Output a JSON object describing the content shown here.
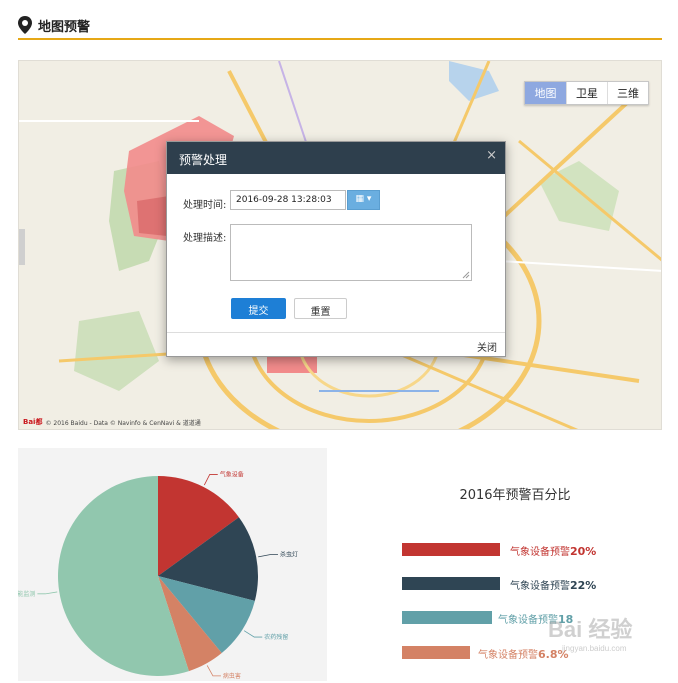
{
  "header": {
    "title": "地图预警"
  },
  "map": {
    "switch": [
      "地图",
      "卫星",
      "三维"
    ],
    "copyright_logo": "Bai都",
    "copyright_text": "© 2016 Baidu - Data © Navinfo & CenNavi & 道道通"
  },
  "modal": {
    "title": "预警处理",
    "close_icon": "×",
    "time_label": "处理时间:",
    "time_value": "2016-09-28 13:28:03",
    "calendar_icon": "▦ ▾",
    "desc_label": "处理描述:",
    "submit_label": "提交",
    "reset_label": "重置",
    "footer_close": "关闭"
  },
  "pie": {
    "labels": [
      "气象设备",
      "杀虫灯",
      "农药残留",
      "病虫害",
      "智能监测"
    ]
  },
  "chart_data": [
    {
      "type": "pie",
      "categories": [
        "气象设备",
        "杀虫灯",
        "农药残留",
        "病虫害",
        "智能监测"
      ],
      "values": [
        15,
        14,
        10,
        6,
        55
      ],
      "colors": [
        "#c23531",
        "#2f4554",
        "#61a0a8",
        "#d48265",
        "#91c7ae"
      ]
    },
    {
      "type": "bar",
      "title": "2016年预警百分比",
      "categories": [
        "气象设备预警",
        "气象设备预警",
        "气象设备预警",
        "气象设备预警"
      ],
      "values": [
        20,
        22,
        18,
        6.8
      ],
      "value_labels": [
        "20%",
        "22%",
        "18",
        "6.8%"
      ],
      "colors": [
        "#c23531",
        "#2f4554",
        "#61a0a8",
        "#d48265"
      ]
    }
  ],
  "watermark": {
    "main": "Bai 经验",
    "sub": "jingyan.baidu.com"
  }
}
